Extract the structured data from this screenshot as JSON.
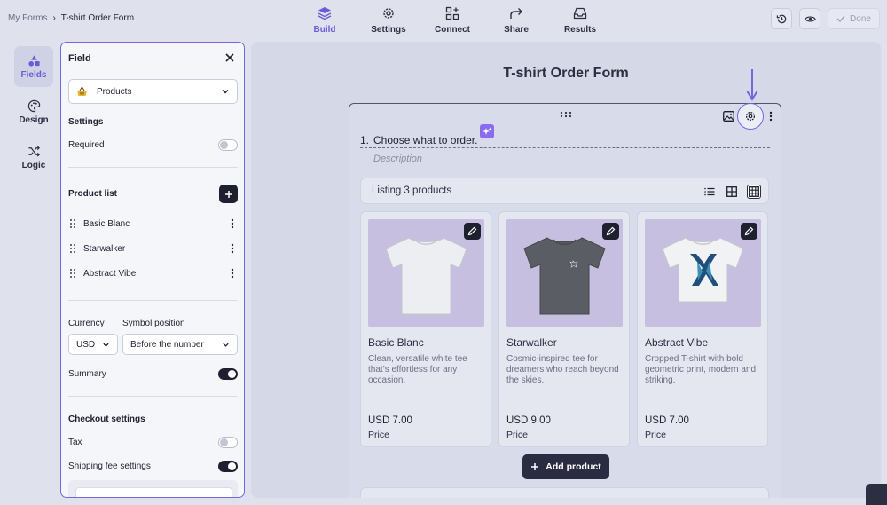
{
  "breadcrumb": {
    "root": "My Forms",
    "separator": "›",
    "current": "T-shirt Order Form"
  },
  "topnav": [
    {
      "label": "Build",
      "icon": "layers-icon",
      "active": true
    },
    {
      "label": "Settings",
      "icon": "gear-icon",
      "active": false
    },
    {
      "label": "Connect",
      "icon": "connect-icon",
      "active": false
    },
    {
      "label": "Share",
      "icon": "share-icon",
      "active": false
    },
    {
      "label": "Results",
      "icon": "inbox-icon",
      "active": false
    }
  ],
  "topright": {
    "history_icon": "history-icon",
    "preview_icon": "eye-icon",
    "done_label": "Done"
  },
  "rail": [
    {
      "label": "Fields",
      "icon": "shapes-icon",
      "active": true
    },
    {
      "label": "Design",
      "icon": "palette-icon",
      "active": false
    },
    {
      "label": "Logic",
      "icon": "shuffle-icon",
      "active": false
    }
  ],
  "panel": {
    "title": "Field",
    "field_type": "Products",
    "settings_title": "Settings",
    "required_label": "Required",
    "required_on": false,
    "product_list_title": "Product list",
    "products": [
      "Basic Blanc",
      "Starwalker",
      "Abstract Vibe"
    ],
    "currency_label": "Currency",
    "currency_value": "USD",
    "symbol_position_label": "Symbol position",
    "symbol_position_value": "Before the number",
    "summary_label": "Summary",
    "summary_on": true,
    "checkout_title": "Checkout settings",
    "tax_label": "Tax",
    "tax_on": false,
    "shipping_label": "Shipping fee settings",
    "shipping_on": true
  },
  "canvas": {
    "form_title": "T-shirt Order Form",
    "question_number": "1.",
    "question_text": "Choose what to order.",
    "description_placeholder": "Description",
    "listing_label": "Listing 3 products",
    "add_product_label": "Add product",
    "product_cards": [
      {
        "name": "Basic Blanc",
        "description": "Clean, versatile white tee that’s effortless for any occasion.",
        "price": "USD 7.00",
        "price_label": "Price",
        "shirt_color": "#eceef2"
      },
      {
        "name": "Starwalker",
        "description": "Cosmic-inspired tee for dreamers who reach beyond the skies.",
        "price": "USD 9.00",
        "price_label": "Price",
        "shirt_color": "#5a5d63"
      },
      {
        "name": "Abstract Vibe",
        "description": "Cropped T-shirt with bold geometric print, modern and striking.",
        "price": "USD 7.00",
        "price_label": "Price",
        "shirt_color": "#f0f2f4"
      }
    ]
  },
  "colors": {
    "accent": "#7566e0",
    "dark": "#1e2030",
    "canvas_bg": "#d5d8e6"
  }
}
